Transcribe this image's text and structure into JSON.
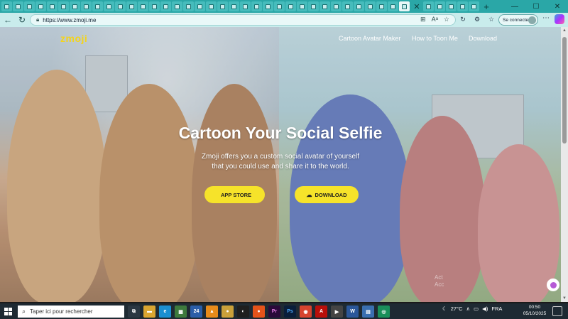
{
  "browser": {
    "url": "https://www.zmoji.me",
    "signin_label": "Se connecter"
  },
  "site": {
    "logo": "zmoji",
    "nav": [
      "Cartoon Avatar Maker",
      "How to Toon Me",
      "Download"
    ],
    "hero_title": "Cartoon Your Social Selfie",
    "hero_subtitle_1": "Zmoji offers you a custom social avatar of yourself",
    "hero_subtitle_2": "that you could use and share it to the world.",
    "app_store_label": "APP STORE",
    "download_label": "DOWNLOAD",
    "watermark_1": "Act",
    "watermark_2": "Acc"
  },
  "taskbar": {
    "search_placeholder": "Taper ici pour rechercher",
    "temperature": "27°C",
    "language": "FRA",
    "time": "00:50",
    "date": "05/10/2025"
  },
  "colors": {
    "accent": "#f6e32a",
    "tabbar": "#2aa7a7",
    "addressbar": "#c9ecec"
  }
}
